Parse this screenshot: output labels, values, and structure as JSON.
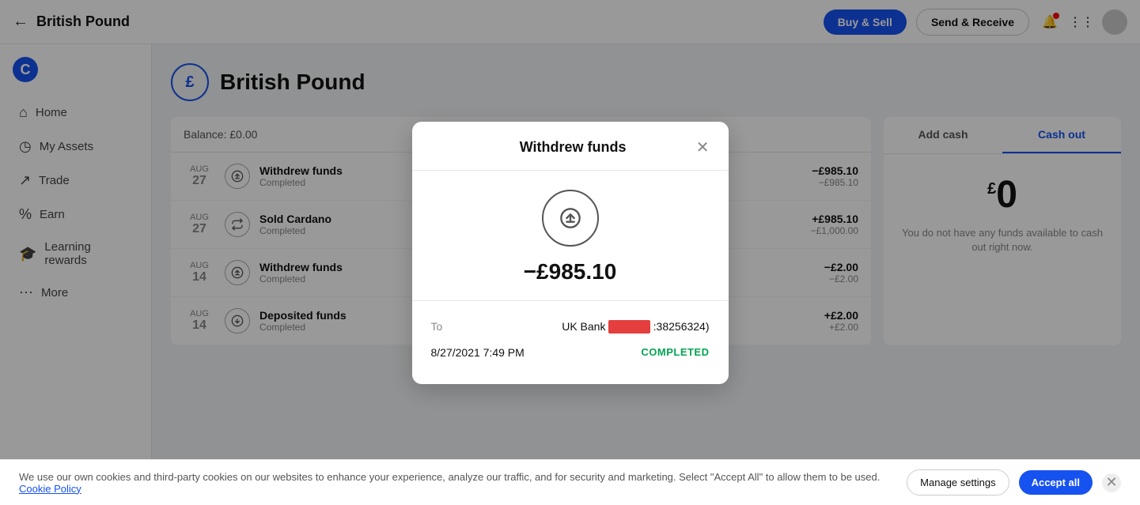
{
  "topNav": {
    "backLabel": "←",
    "title": "British Pound",
    "buyAndSell": "Buy & Sell",
    "sendAndReceive": "Send & Receive"
  },
  "sidebar": {
    "logo": "C",
    "items": [
      {
        "id": "home",
        "label": "Home",
        "icon": "⌂"
      },
      {
        "id": "my-assets",
        "label": "My Assets",
        "icon": "◷"
      },
      {
        "id": "trade",
        "label": "Trade",
        "icon": "↗"
      },
      {
        "id": "earn",
        "label": "Earn",
        "icon": "%"
      },
      {
        "id": "learning-rewards",
        "label": "Learning rewards",
        "icon": "🎓"
      },
      {
        "id": "more",
        "label": "More",
        "icon": "⋯"
      }
    ]
  },
  "assetPage": {
    "assetIcon": "£",
    "assetTitle": "British Pound",
    "balance": "Balance: £0.00",
    "transactions": [
      {
        "month": "AUG",
        "day": "27",
        "name": "Withdrew funds",
        "status": "Completed",
        "iconType": "up",
        "amountMain": "−£985.10",
        "amountSub": "−£985.10",
        "amountPos": false
      },
      {
        "month": "AUG",
        "day": "27",
        "name": "Sold Cardano",
        "status": "Completed",
        "iconType": "swap",
        "amountMain": "+£985.10",
        "amountSub": "−£1,000.00",
        "amountPos": true
      },
      {
        "month": "AUG",
        "day": "14",
        "name": "Withdrew funds",
        "status": "Completed",
        "iconType": "up",
        "amountMain": "−£2.00",
        "amountSub": "−£2.00",
        "amountPos": false
      },
      {
        "month": "AUG",
        "day": "14",
        "name": "Deposited funds",
        "status": "Completed",
        "iconType": "down",
        "amountMain": "+£2.00",
        "amountSub": "+£2.00",
        "amountPos": true
      }
    ],
    "rightPanel": {
      "addCashTab": "Add cash",
      "cashOutTab": "Cash out",
      "cashOutAmount": "0",
      "cashOutCurrency": "£",
      "cashOutDesc": "You do not have any funds available to cash out right now."
    }
  },
  "modal": {
    "title": "Withdrew funds",
    "amount": "−£985.10",
    "toLabel": "To",
    "toValue": "UK Bank",
    "toRedacted": "••••••••",
    "toAccount": ":38256324)",
    "dateLabel": "",
    "dateValue": "8/27/2021 7:49 PM",
    "statusValue": "COMPLETED"
  },
  "cookie": {
    "text": "We use our own cookies and third-party cookies on our websites to enhance your experience, analyze our traffic, and for security and marketing. Select \"Accept All\" to allow them to be used.",
    "cookiePolicyLabel": "Cookie Policy",
    "manageSettings": "Manage settings",
    "acceptAll": "Accept all"
  }
}
